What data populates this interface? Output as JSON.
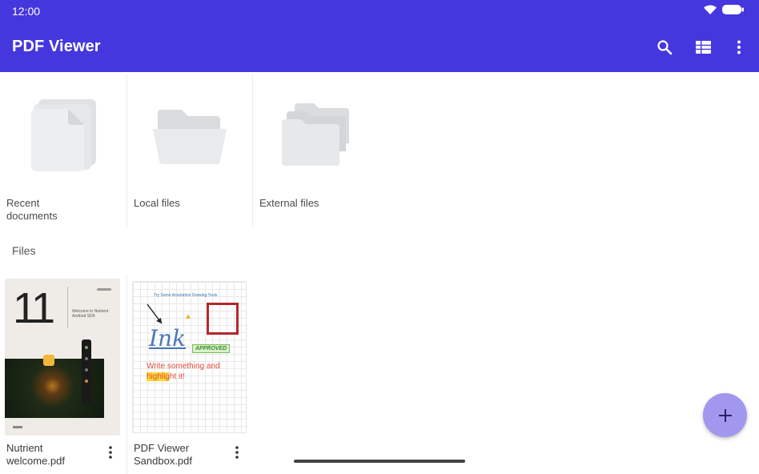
{
  "status_bar": {
    "time": "12:00"
  },
  "app_bar": {
    "title": "PDF Viewer",
    "actions": [
      "search-icon",
      "grid-view-icon",
      "more-vertical-icon"
    ]
  },
  "locations": [
    {
      "label": "Recent documents",
      "icon": "recent-documents-icon"
    },
    {
      "label": "Local files",
      "icon": "folder-icon"
    },
    {
      "label": "External files",
      "icon": "external-folders-icon"
    }
  ],
  "files_section": {
    "heading": "Files"
  },
  "files": [
    {
      "name": "Nutrient welcome.pdf",
      "thumbnail": {
        "big_number": "11",
        "caption": "Welcome to Nutrient Android SDK"
      }
    },
    {
      "name": "PDF Viewer Sandbox.pdf",
      "thumbnail": {
        "header": "Try Some Annotation Drawing Tools",
        "ink_text": "Ink",
        "stamp_text": "APPROVED",
        "note_line1": "Write something and",
        "note_line2": "highlight it!"
      }
    }
  ],
  "fab": {
    "icon": "plus-icon"
  },
  "colors": {
    "app_bar": "#4537de",
    "fab": "#a297ee",
    "accent_red": "#b4272c"
  }
}
